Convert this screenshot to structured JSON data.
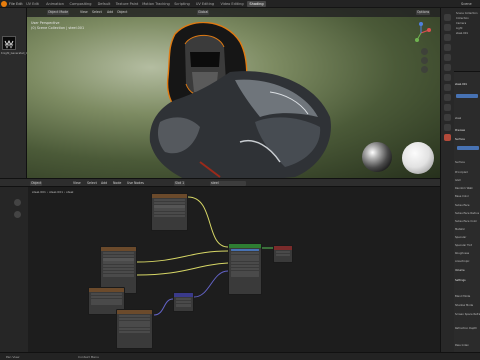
{
  "app": {
    "name": "Blender"
  },
  "topbar": {
    "menus": [
      "File",
      "Edit",
      "Render",
      "Window",
      "Help"
    ],
    "workspace_tabs": [
      "UV Edit",
      "Animation",
      "Compositing",
      "Default",
      "Texture Paint",
      "Motion Tracking",
      "Scripting",
      "UV Editing",
      "Video Editing",
      "Shading"
    ],
    "active_tab": "Shading",
    "scene_label": "Scene"
  },
  "left_panel": {
    "image_name": "Knight_Generated_Chainmail_Helmet_04"
  },
  "viewport": {
    "mode": "Object Mode",
    "menus": [
      "View",
      "Select",
      "Add",
      "Object"
    ],
    "transform": "Global",
    "options_label": "Options",
    "view_name": "User Perspective",
    "collection_info": "(0) Scene Collection | steel.001"
  },
  "outliner": {
    "rows": [
      "Scene Collection",
      "Collection",
      "Camera",
      "Light",
      "steel.001"
    ]
  },
  "properties": {
    "material_name": "steel.001",
    "active_material": "steel",
    "rows": [
      "Preview",
      "Surface",
      "Use Nodes",
      "Surface",
      "Principled",
      "GGX",
      "Random Walk",
      "Base Color",
      "Subsurface",
      "Subsurface Radius",
      "Subsurface Color",
      "Metallic",
      "Specular",
      "Specular Tint",
      "Roughness",
      "Anisotropic",
      "Sheen",
      "Clearcoat",
      "Clearcoat Roughness",
      "IOR",
      "Transmission",
      "Volume",
      "Settings",
      "Blend Mode",
      "Shadow Mode",
      "Screen Space Refraction",
      "Refraction Depth",
      "Pass Index"
    ]
  },
  "node_editor": {
    "type": "Object",
    "menus": [
      "View",
      "Select",
      "Add",
      "Node"
    ],
    "use_nodes_label": "Use Nodes",
    "slot": "Slot 1",
    "material": "steel",
    "breadcrumb": [
      "steel.001",
      "steel.001",
      "steel"
    ],
    "sidebar_label": "Image Texture"
  },
  "footer": {
    "items": [
      "Pan View",
      "Context Menu"
    ]
  },
  "colors": {
    "accent": "#e87d0d",
    "active_blue": "#4772b3",
    "node_header_texture": "#6b4a2b",
    "node_header_shader": "#2e7d32",
    "node_header_output": "#7a2b2b",
    "node_header_vector": "#3a3a8a",
    "wire_yellow": "#d7d766",
    "wire_purple": "#6363c7",
    "wire_grey": "#a1a1a1"
  }
}
